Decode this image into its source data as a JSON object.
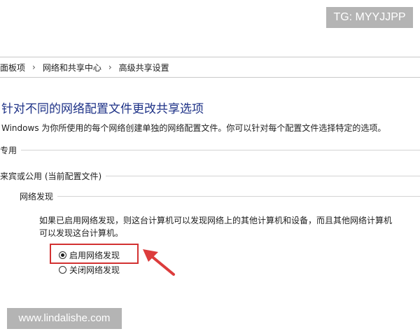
{
  "watermarks": {
    "top": "TG: MYYJJPP",
    "bottom": "www.lindalishe.com"
  },
  "breadcrumb": {
    "items": [
      "面板项",
      "网络和共享中心",
      "高级共享设置"
    ],
    "separator": "›"
  },
  "page": {
    "title": "针对不同的网络配置文件更改共享选项",
    "description": "Windows 为你所使用的每个网络创建单独的网络配置文件。你可以针对每个配置文件选择特定的选项。"
  },
  "sections": {
    "private": {
      "label": "专用",
      "toggle_icon": "chevron-down-icon"
    },
    "guest_public": {
      "label": "来宾或公用 (当前配置文件)",
      "toggle_icon": "chevron-up-icon"
    }
  },
  "network_discovery": {
    "label": "网络发现",
    "info_lines": [
      "如果已启用网络发现，则这台计算机可以发现网络上的其他计算机和设备，而且其他网络计算机",
      "可以发现这台计算机。"
    ],
    "options": [
      {
        "label": "启用网络发现",
        "selected": true
      },
      {
        "label": "关闭网络发现",
        "selected": false
      }
    ]
  },
  "annotations": {
    "highlight_color": "#d23232",
    "arrow_color": "#dc3c3c"
  },
  "colors": {
    "title": "#1e3287",
    "text": "#1e1e1e",
    "watermark_bg": "#b4b4b4",
    "divider": "#d4d4d4"
  }
}
